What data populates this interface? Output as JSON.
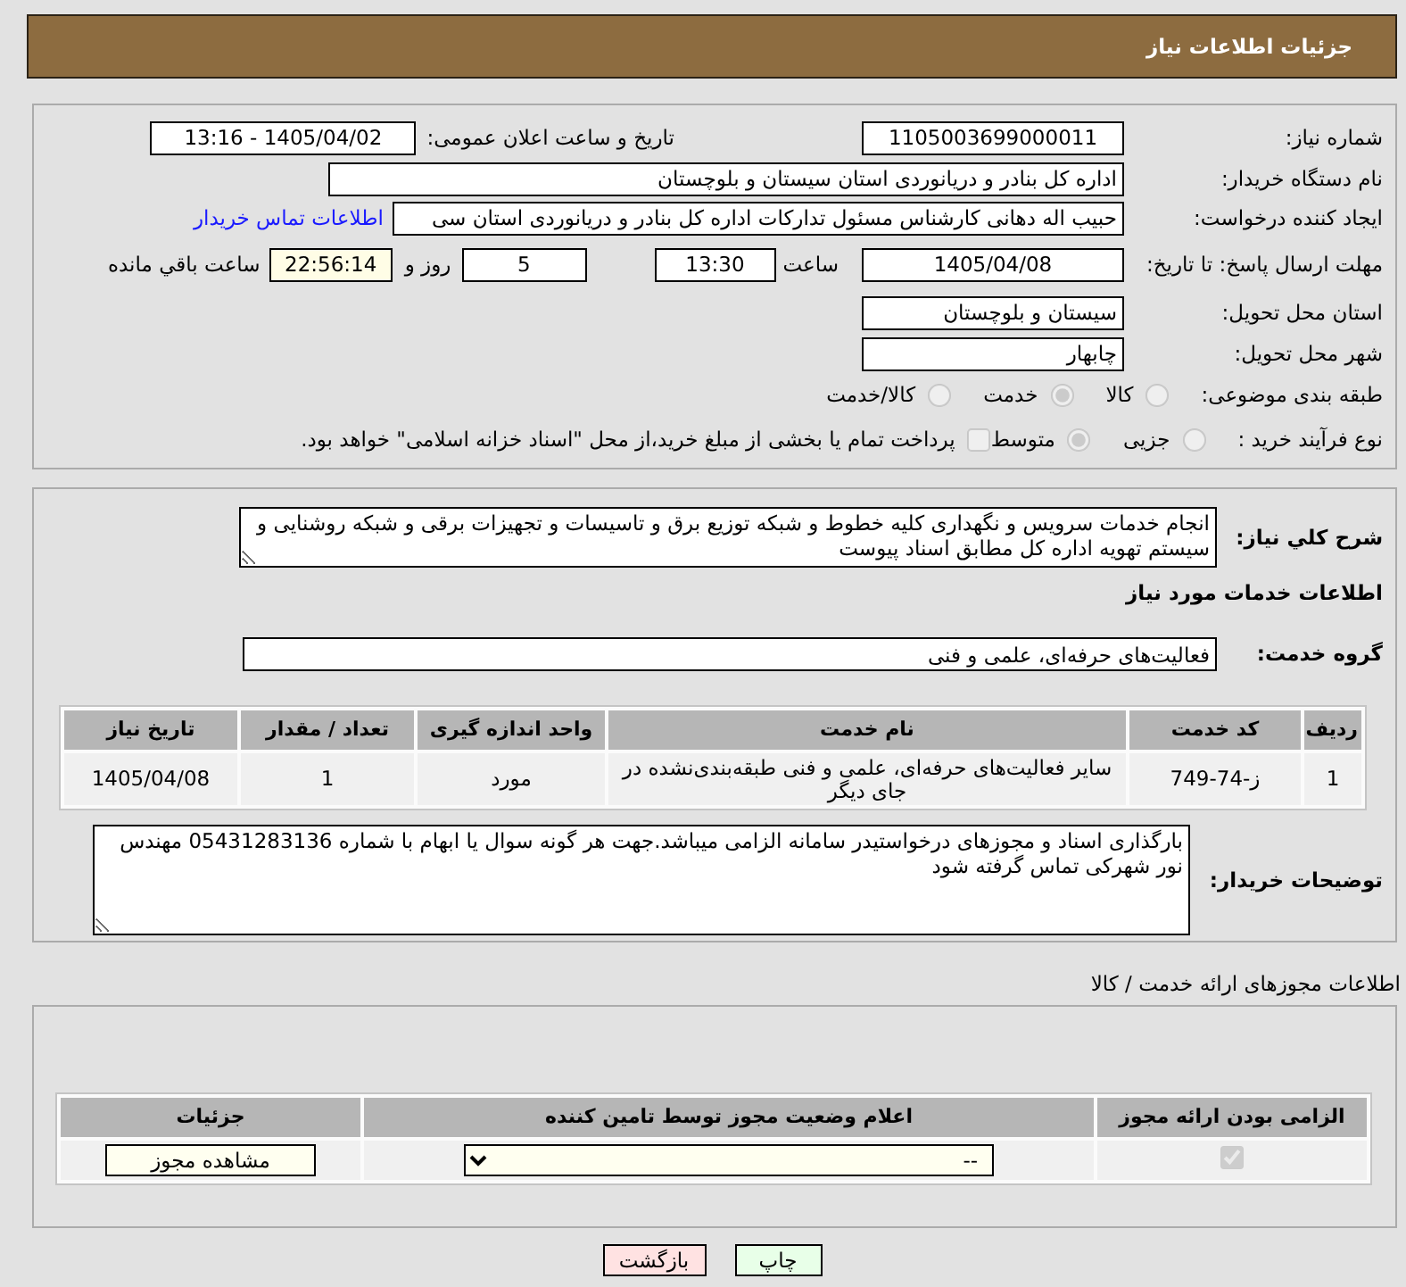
{
  "header": {
    "title": "جزئیات اطلاعات نیاز"
  },
  "details": {
    "need_number": {
      "label": "شماره نیاز:",
      "value": "1105003699000011"
    },
    "announced": {
      "label": "تاریخ و ساعت اعلان عمومی:",
      "value": "1405/04/02 - 13:16"
    },
    "buyer_org": {
      "label": "نام دستگاه خریدار:",
      "value": "اداره کل بنادر و دریانوردی استان سیستان و بلوچستان"
    },
    "requester": {
      "label": "ایجاد کننده درخواست:",
      "value": "حبیب اله دهانی کارشناس مسئول تدارکات اداره کل بنادر و دریانوردی استان سی",
      "link": "اطلاعات تماس خریدار"
    },
    "deadline": {
      "label": "مهلت ارسال پاسخ: تا تاریخ:",
      "date": "1405/04/08",
      "time_label": "ساعت",
      "time": "13:30",
      "days": "5",
      "days_label": "روز و",
      "remaining": "22:56:14",
      "remaining_label": "ساعت باقي مانده"
    },
    "delivery_province": {
      "label": "استان محل تحویل:",
      "value": "سیستان و بلوچستان"
    },
    "delivery_city": {
      "label": "شهر محل تحویل:",
      "value": "چابهار"
    },
    "category": {
      "label": "طبقه بندی موضوعی:",
      "options": [
        {
          "label": "کالا",
          "selected": false,
          "disabled": true
        },
        {
          "label": "خدمت",
          "selected": true,
          "disabled": true
        },
        {
          "label": "کالا/خدمت",
          "selected": false,
          "disabled": true
        }
      ]
    },
    "process": {
      "label": "نوع فرآیند خرید :",
      "options": [
        {
          "label": "جزیی",
          "selected": false,
          "disabled": true
        },
        {
          "label": "متوسط",
          "selected": true,
          "disabled": true
        }
      ],
      "treasury": {
        "label": "پرداخت تمام یا بخشی از مبلغ خرید،از محل \"اسناد خزانه اسلامی\" خواهد بود.",
        "checked": false,
        "disabled": true
      }
    }
  },
  "description": {
    "label": "شرح کلي نیاز:",
    "text": "انجام خدمات سرویس و نگهداری کلیه خطوط و شبکه توزیع برق و تاسیسات و تجهیزات برقی و شبکه روشنایی و سیستم تهویه اداره کل مطابق اسناد پیوست"
  },
  "services": {
    "title": "اطلاعات خدمات مورد نیاز",
    "group_label": "گروه خدمت:",
    "group": "فعالیت‌های حرفه‌ای، علمی و فنی",
    "table": {
      "columns": [
        "ردیف",
        "کد خدمت",
        "نام خدمت",
        "واحد اندازه گیری",
        "تعداد / مقدار",
        "تاریخ نیاز"
      ],
      "rows": [
        [
          "1",
          "ز-74-749",
          "سایر فعالیت‌های حرفه‌ای، علمی و فنی طبقه‌بندی‌نشده در جای دیگر",
          "مورد",
          "1",
          "1405/04/08"
        ]
      ]
    }
  },
  "buyer_notes": {
    "label": "توضیحات خریدار:",
    "text": "بارگذاری اسناد و مجوزهای درخواستیدر سامانه الزامی میباشد.جهت هر گونه سوال یا ابهام با شماره 05431283136 مهندس نور شهرکی تماس گرفته شود"
  },
  "permits": {
    "title": "اطلاعات مجوزهای ارائه خدمت / کالا",
    "table": {
      "columns": [
        "الزامی بودن ارائه مجوز",
        "اعلام وضعیت مجوز توسط تامین کننده",
        "جزئیات"
      ],
      "rows": [
        {
          "required": {
            "checked": true,
            "disabled": true
          },
          "status": "--",
          "action": "مشاهده مجوز"
        }
      ]
    }
  },
  "buttons": [
    {
      "kind": "print",
      "label": "چاپ"
    },
    {
      "kind": "back",
      "label": "بازگشت"
    }
  ]
}
